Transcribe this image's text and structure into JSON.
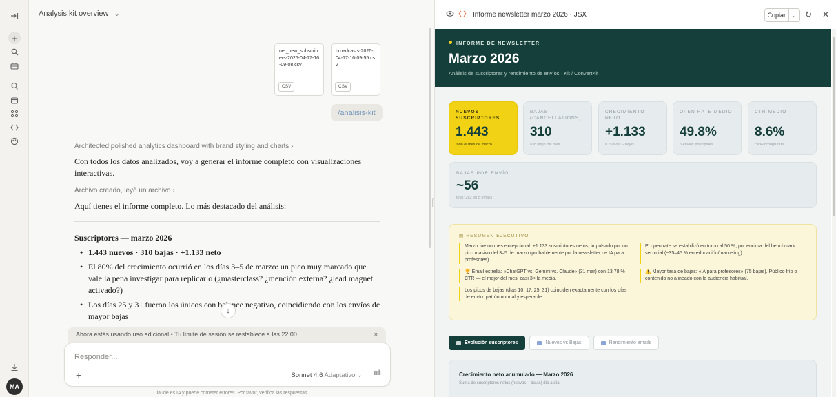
{
  "chat": {
    "title": "Analysis kit overview",
    "files": [
      {
        "name": "net_new_subscribers-2026-04-17-16-09-08.csv",
        "type": "CSV"
      },
      {
        "name": "broadcasts-2026-04-17-16-09-55.csv",
        "type": "CSV"
      }
    ],
    "user_message": "/analisis-kit",
    "thinking_summary": "Architected polished analytics dashboard with brand styling and charts",
    "intro_text": "Con todos los datos analizados, voy a generar el informe completo con visualizaciones interactivas.",
    "file_action": "Archivo creado, leyó un archivo",
    "highlight_intro": "Aquí tienes el informe completo. Lo más destacado del análisis:",
    "section_title": "Suscriptores — marzo 2026",
    "bullets": [
      "1.443 nuevos · 310 bajas · +1.133 neto",
      "El 80% del crecimiento ocurrió en los días 3–5 de marzo: un pico muy marcado que vale la pena investigar para replicarlo (¿masterclass? ¿mención externa? ¿lead magnet activado?)",
      "Los días 25 y 31 fueron los únicos con balance negativo, coincidiendo con los envíos de mayor bajas"
    ],
    "usage_notice": "Ahora estás usando uso adicional • Tu límite de sesión se restablece a las 22:00",
    "usage_close": "×",
    "composer_placeholder": "Responder...",
    "model_name": "Sonnet 4.6",
    "model_mode": "Adaptativo",
    "disclaimer": "Claude es IA y puede cometer errores. Por favor, verifica las respuestas."
  },
  "artifact": {
    "title": "Informe newsletter marzo 2026 · JSX",
    "copy_label": "Copiar",
    "hero": {
      "eyebrow": "INFORME DE NEWSLETTER",
      "heading": "Marzo 2026",
      "subheading": "Análisis de suscriptores y rendimiento de envíos · Kit / ConvertKit"
    },
    "kpis": [
      {
        "label": "NUEVOS SUSCRIPTORES",
        "value": "1.443",
        "note": "todo el mes de marzo"
      },
      {
        "label": "BAJAS (CANCELLATIONS)",
        "value": "310",
        "note": "a lo largo del mes"
      },
      {
        "label": "CRECIMIENTO NETO",
        "value": "+1.133",
        "note": "= nuevos − bajas"
      },
      {
        "label": "OPEN RATE MEDIO",
        "value": "49.8%",
        "note": "5 envíos principales"
      },
      {
        "label": "CTR MEDIO",
        "value": "8.6%",
        "note": "click-through rate"
      }
    ],
    "wide_kpi": {
      "label": "BAJAS POR ENVÍO",
      "value": "~56",
      "note": "total: 282 en 5 emails"
    },
    "summary": {
      "title": "RESUMEN EJECUTIVO",
      "items": [
        "Marzo fue un mes excepcional: +1.133 suscriptores netos, impulsado por un pico masivo del 3–5 de marzo (probablemente por la newsletter de IA para profesores).",
        "El open rate se estabilizó en torno al 50 %, por encima del benchmark sectorial (~35–45 % en educación/marketing).",
        "🏆 Email estrella: «ChatGPT vs. Gemini vs. Claude» (31 mar) con 13,78 % CTR — el mejor del mes, casi 3× la media.",
        "⚠️ Mayor tasa de bajas: «IA para profesores» (75 bajas). Público frío o contenido no alineado con la audiencia habitual.",
        "Los picos de bajas (días 10, 17, 25, 31) coinciden exactamente con los días de envío: patrón normal y esperable."
      ]
    },
    "tabs": [
      "Evolución suscriptores",
      "Nuevos vs Bajas",
      "Rendimiento emails"
    ],
    "chart_card": {
      "title": "Crecimiento neto acumulado — Marzo 2026",
      "subtitle": "Suma de suscriptores netos (nuevos − bajas) día a día"
    }
  }
}
